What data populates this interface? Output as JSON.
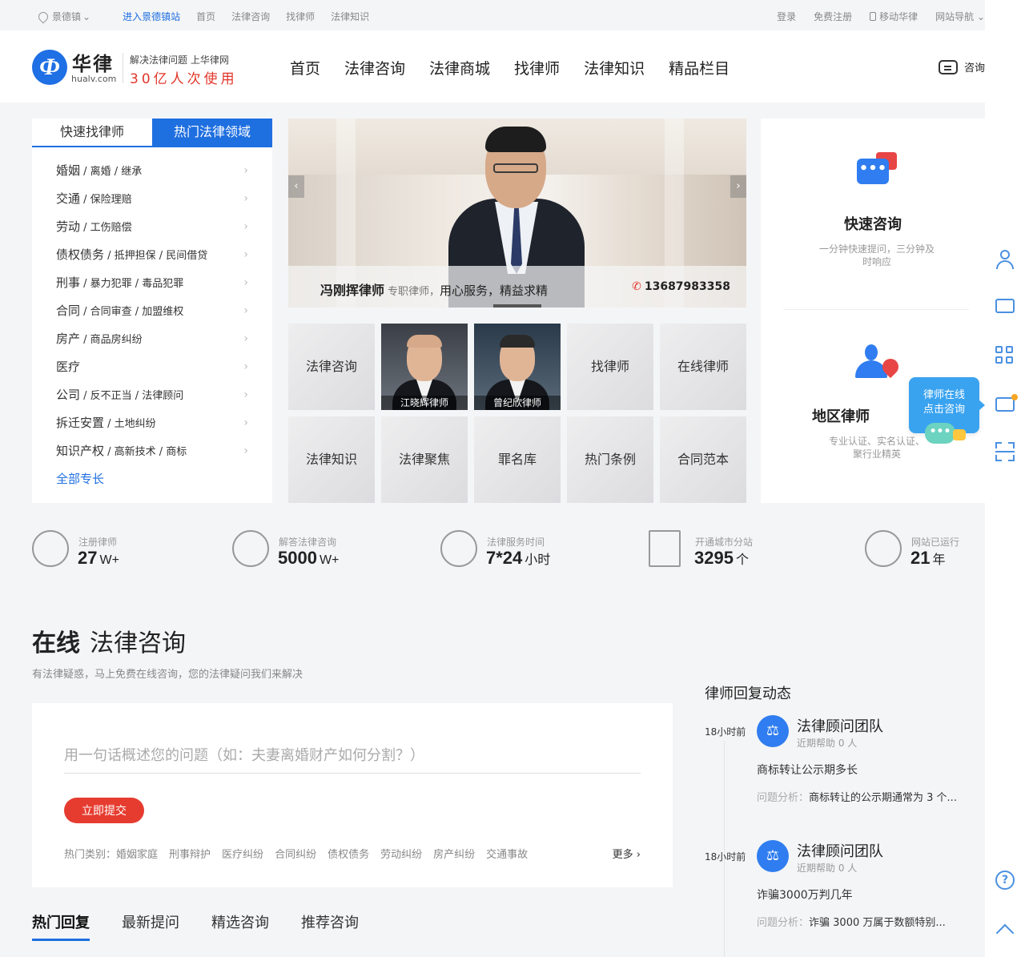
{
  "topbar": {
    "location": "景德镇",
    "enter_station": "进入景德镇站",
    "links": [
      "首页",
      "法律咨询",
      "找律师",
      "法律知识"
    ],
    "login": "登录",
    "register": "免费注册",
    "mobile": "移动华律",
    "site_nav": "网站导航"
  },
  "header": {
    "logo_glyph": "Ф",
    "brand": "华律",
    "domain": "hualv.com",
    "slogan_top": "解决法律问题 上华律网",
    "slogan_bottom": "30亿人次使用",
    "nav": [
      "首页",
      "法律咨询",
      "法律商城",
      "找律师",
      "法律知识",
      "精品栏目"
    ],
    "consult_label": "咨询"
  },
  "category_panel": {
    "tabs": [
      "快速找律师",
      "热门法律领域"
    ],
    "active_tab": 1,
    "items": [
      {
        "main": "婚姻",
        "sub": " / 离婚 / 继承"
      },
      {
        "main": "交通",
        "sub": " / 保险理赔"
      },
      {
        "main": "劳动",
        "sub": " / 工伤赔偿"
      },
      {
        "main": "债权债务",
        "sub": " / 抵押担保 / 民间借贷"
      },
      {
        "main": "刑事",
        "sub": " / 暴力犯罪 / 毒品犯罪"
      },
      {
        "main": "合同",
        "sub": " / 合同审查 / 加盟维权"
      },
      {
        "main": "房产",
        "sub": " / 商品房纠纷"
      },
      {
        "main": "医疗",
        "sub": ""
      },
      {
        "main": "公司",
        "sub": " / 反不正当 / 法律顾问"
      },
      {
        "main": "拆迁安置",
        "sub": " / 土地纠纷"
      },
      {
        "main": "知识产权",
        "sub": " / 高新技术 / 商标"
      }
    ],
    "all_label": "全部专长"
  },
  "banner": {
    "lawyer_name": "冯刚挥律师",
    "lawyer_type": "专职律师，",
    "motto": "用心服务，精益求精",
    "phone": "13687983358",
    "prev": "‹",
    "next": "›"
  },
  "tiles": {
    "row1": [
      "法律咨询",
      "江晓辉律师",
      "曾纪欣律师",
      "找律师",
      "在线律师"
    ],
    "row2": [
      "法律知识",
      "法律聚焦",
      "罪名库",
      "热门条例",
      "合同范本"
    ]
  },
  "quick": {
    "consult_title": "快速咨询",
    "consult_desc": "一分钟快速提问，三分钟及时响应",
    "region_title": "地区律师",
    "region_desc": "专业认证、实名认证、聚行业精英",
    "float_line1": "律师在线",
    "float_line2": "点击咨询",
    "bubble_dots": "•••"
  },
  "stats": [
    {
      "label": "注册律师",
      "value": "27",
      "unit": "W+"
    },
    {
      "label": "解答法律咨询",
      "value": "5000",
      "unit": "W+"
    },
    {
      "label": "法律服务时间",
      "value": "7*24",
      "unit": "小时"
    },
    {
      "label": "开通城市分站",
      "value": "3295",
      "unit": "个"
    },
    {
      "label": "网站已运行",
      "value": "21",
      "unit": "年"
    }
  ],
  "consult_section": {
    "title_bold": "在线",
    "title_rest": "法律咨询",
    "subtitle": "有法律疑惑，马上免费在线咨询，您的法律疑问我们来解决",
    "input_placeholder": "用一句话概述您的问题（如：夫妻离婚财产如何分割？）",
    "submit": "立即提交",
    "hot_label": "热门类别：",
    "hot": [
      "婚姻家庭",
      "刑事辩护",
      "医疗纠纷",
      "合同纠纷",
      "债权债务",
      "劳动纠纷",
      "房产纠纷",
      "交通事故"
    ],
    "more": "更多 ›",
    "tabs": [
      "热门回复",
      "最新提问",
      "精选咨询",
      "推荐咨询"
    ]
  },
  "feed": {
    "title": "律师回复动态",
    "items": [
      {
        "time": "18小时前",
        "team": "法律顾问团队",
        "helped": "近期帮助 0 人",
        "question": "商标转让公示期多长",
        "analysis_label": "问题分析：",
        "analysis": "商标转让的公示期通常为 3 个..."
      },
      {
        "time": "18小时前",
        "team": "法律顾问团队",
        "helped": "近期帮助 0 人",
        "question": "诈骗3000万判几年",
        "analysis_label": "问题分析：",
        "analysis": "诈骗 3000 万属于数额特别..."
      }
    ]
  },
  "sidebar": {
    "help_glyph": "?"
  },
  "colors": {
    "brand_blue": "#1e6fe0",
    "accent_red": "#e63c30"
  }
}
